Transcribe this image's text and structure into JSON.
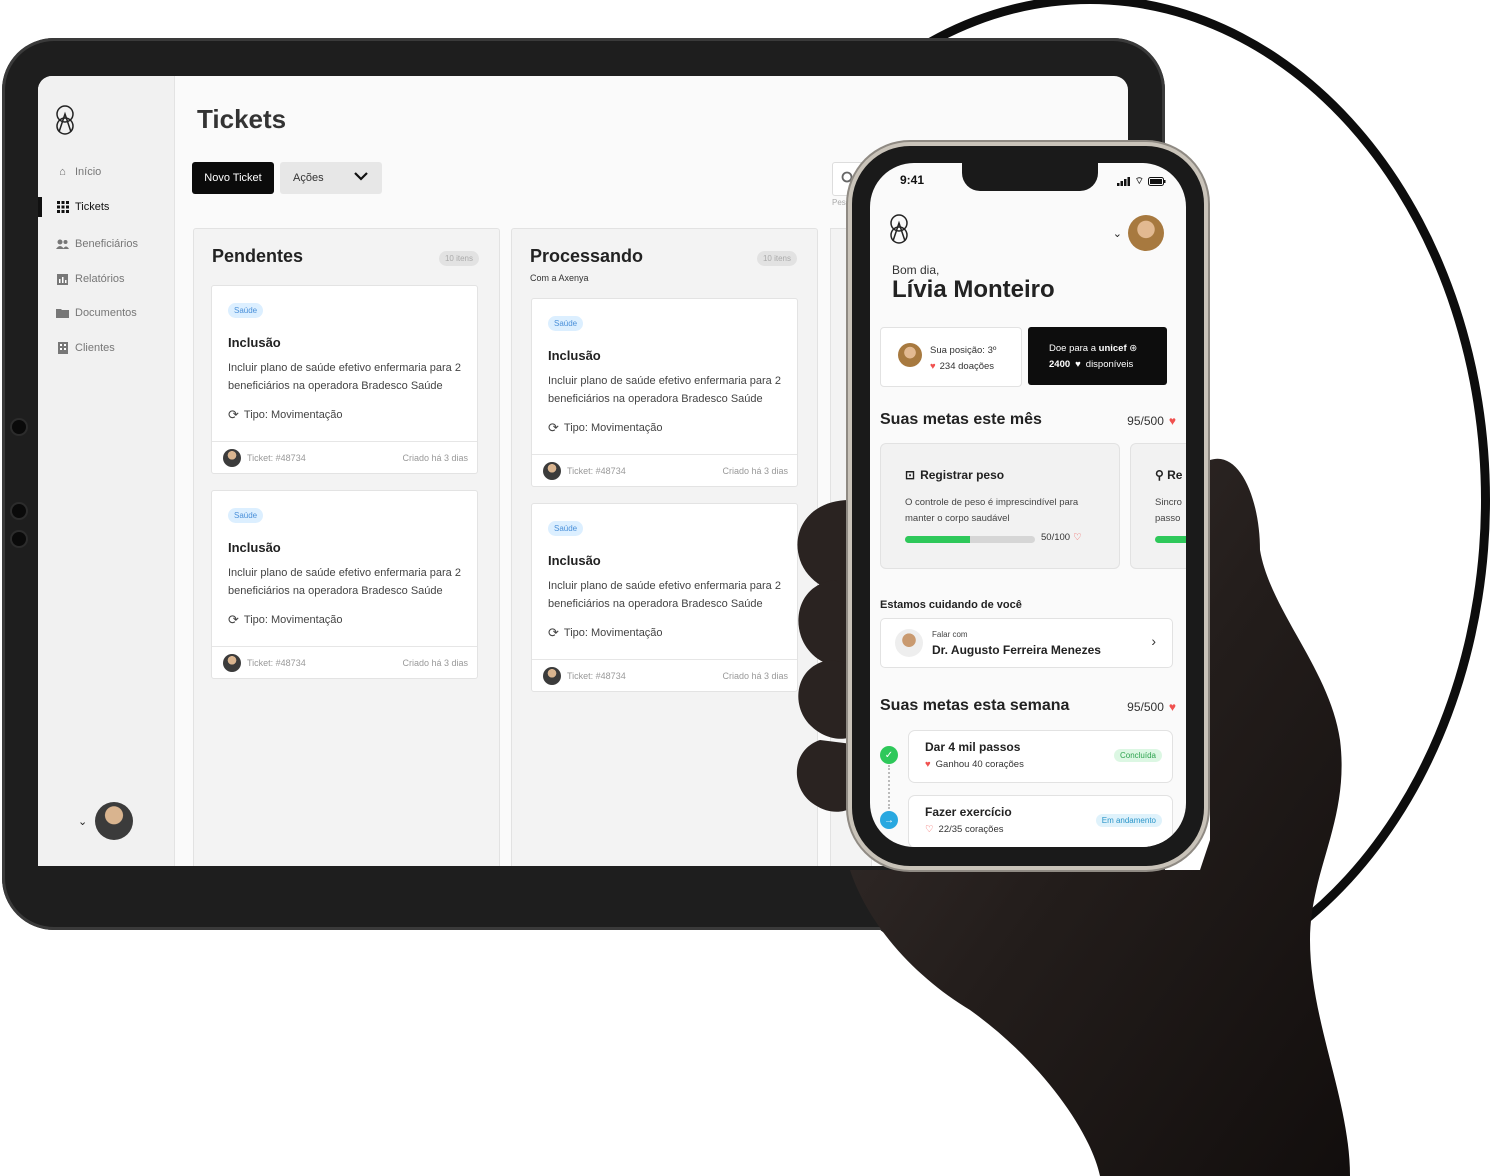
{
  "tablet": {
    "sidebar": {
      "items": [
        {
          "label": "Início",
          "icon": "home-icon"
        },
        {
          "label": "Tickets",
          "icon": "grid-icon"
        },
        {
          "label": "Beneficiários",
          "icon": "users-icon"
        },
        {
          "label": "Relatórios",
          "icon": "chart-icon"
        },
        {
          "label": "Documentos",
          "icon": "folder-icon"
        },
        {
          "label": "Clientes",
          "icon": "building-icon"
        }
      ],
      "active": "Tickets"
    },
    "page_title": "Tickets",
    "toolbar": {
      "new_ticket": "Novo Ticket",
      "actions": "Ações",
      "search_hint": "Pesq"
    },
    "columns": [
      {
        "title": "Pendentes",
        "subtitle": "",
        "count": "10 itens",
        "cards": [
          {
            "badge": "Saúde",
            "title": "Inclusão",
            "desc": "Incluir plano de saúde efetivo enfermaria para 2 beneficiários na operadora Bradesco Saúde",
            "type": "Tipo: Movimentação",
            "ticket": "Ticket: #48734",
            "created": "Criado há 3 dias"
          },
          {
            "badge": "Saúde",
            "title": "Inclusão",
            "desc": "Incluir plano de saúde efetivo enfermaria para 2 beneficiários na operadora Bradesco Saúde",
            "type": "Tipo: Movimentação",
            "ticket": "Ticket: #48734",
            "created": "Criado há 3 dias"
          }
        ]
      },
      {
        "title": "Processando",
        "subtitle": "Com a Axenya",
        "count": "10 itens",
        "cards": [
          {
            "badge": "Saúde",
            "title": "Inclusão",
            "desc": "Incluir plano de saúde efetivo enfermaria para 2 beneficiários na operadora Bradesco Saúde",
            "type": "Tipo: Movimentação",
            "ticket": "Ticket: #48734",
            "created": "Criado há 3 dias"
          },
          {
            "badge": "Saúde",
            "title": "Inclusão",
            "desc": "Incluir plano de saúde efetivo enfermaria para 2 beneficiários na operadora Bradesco Saúde",
            "type": "Tipo: Movimentação",
            "ticket": "Ticket: #48734",
            "created": "Criado há 3 dias"
          }
        ]
      }
    ]
  },
  "phone": {
    "time": "9:41",
    "greeting": "Bom dia,",
    "user_name": "Lívia Monteiro",
    "position": {
      "label": "Sua posição: 3º",
      "donations": "234 doações"
    },
    "donate": {
      "label": "Doe para a",
      "brand": "unicef",
      "amount": "2400",
      "available": "disponíveis"
    },
    "month_goals": {
      "title": "Suas metas este mês",
      "score": "95/500",
      "cards": [
        {
          "title": "Registrar peso",
          "desc": "O controle de peso é imprescindível para manter o corpo saudável",
          "value": "50/100",
          "progress": 0.5
        },
        {
          "title": "Re",
          "desc": "Sincro\npasso",
          "progress": 1.0
        }
      ]
    },
    "care": {
      "title": "Estamos cuidando de você",
      "talk_with": "Falar com",
      "doctor": "Dr. Augusto Ferreira Menezes"
    },
    "week_goals": {
      "title": "Suas metas esta semana",
      "score": "95/500",
      "items": [
        {
          "title": "Dar 4 mil passos",
          "desc": "Ganhou 40 corações",
          "status": "Concluída",
          "status_color": "#2ec85a"
        },
        {
          "title": "Fazer exercício",
          "desc": "22/35 corações",
          "status": "Em andamento",
          "status_color": "#29a8e0"
        }
      ]
    }
  }
}
